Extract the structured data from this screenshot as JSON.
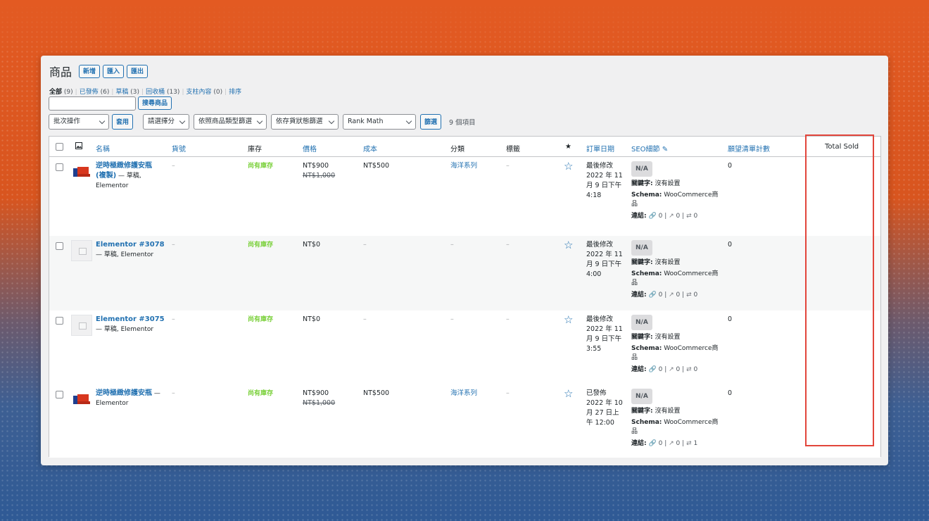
{
  "page": {
    "title": "商品",
    "buttons": [
      "新增",
      "匯入",
      "匯出"
    ]
  },
  "status_links": [
    {
      "label": "全部",
      "count": "(9)",
      "current": true
    },
    {
      "label": "已發佈",
      "count": "(6)"
    },
    {
      "label": "草稿",
      "count": "(3)"
    },
    {
      "label": "回收桶",
      "count": "(13)"
    },
    {
      "label": "支柱內容",
      "count": "(0)"
    },
    {
      "label": "排序",
      "count": ""
    }
  ],
  "search": {
    "button": "搜尋商品",
    "value": ""
  },
  "filters": {
    "bulk": "批次操作",
    "apply": "套用",
    "category": "請選擇分",
    "type": "依照商品類型篩選",
    "stock": "依存貨狀態篩選",
    "rankmath": "Rank Math",
    "filter_btn": "篩選",
    "count": "9 個項目"
  },
  "columns": {
    "name": "名稱",
    "sku": "貨號",
    "stock": "庫存",
    "price": "價格",
    "cost": "成本",
    "category": "分類",
    "tags": "標籤",
    "star": "★",
    "date": "訂單日期",
    "seo": "SEO細節",
    "wishlist": "願望清單計數",
    "total_sold": "Total Sold"
  },
  "seo_labels": {
    "keyword": "關鍵字:",
    "schema": "Schema:",
    "links": "連結:"
  },
  "rows": [
    {
      "name": "逆時極緻修護安瓶(複製)",
      "name_line1": "逆時極緻修護安瓶",
      "name_line2": "(複製)",
      "name_suffix": " — 草稿,",
      "meta": "Elementor",
      "thumb": "product-image",
      "sku": "–",
      "stock": "尚有庫存",
      "price": "NT$900",
      "price_old": "NT$1,000",
      "cost": "NT$500",
      "category": "海洋系列",
      "tags": "–",
      "date_status": "最後修改",
      "date_lines": [
        "2022 年 11",
        "月 9 日下午",
        "4:18"
      ],
      "seo_score": "N/A",
      "keyword": "沒有設置",
      "schema": "WooCommerce商品",
      "schema_l1": "WooCommerce商",
      "schema_l2": "品",
      "links_internal": "0",
      "links_external": "0",
      "links_incoming": "0",
      "wishlist": "0"
    },
    {
      "name": "Elementor #3078",
      "name_line1": "Elementor #3078",
      "name_line2": "",
      "name_suffix": "",
      "meta": "— 草稿, Elementor",
      "thumb": "placeholder",
      "sku": "–",
      "stock": "尚有庫存",
      "price": "NT$0",
      "price_old": "",
      "cost": "–",
      "category": "–",
      "tags": "–",
      "date_status": "最後修改",
      "date_lines": [
        "2022 年 11",
        "月 9 日下午",
        "4:00"
      ],
      "seo_score": "N/A",
      "keyword": "沒有設置",
      "schema_l1": "WooCommerce商",
      "schema_l2": "品",
      "links_internal": "0",
      "links_external": "0",
      "links_incoming": "0",
      "wishlist": "0"
    },
    {
      "name": "Elementor #3075",
      "name_line1": "Elementor #3075",
      "name_line2": "",
      "name_suffix": "",
      "meta": "— 草稿, Elementor",
      "thumb": "placeholder",
      "sku": "–",
      "stock": "尚有庫存",
      "price": "NT$0",
      "price_old": "",
      "cost": "–",
      "category": "–",
      "tags": "–",
      "date_status": "最後修改",
      "date_lines": [
        "2022 年 11",
        "月 9 日下午",
        "3:55"
      ],
      "seo_score": "N/A",
      "keyword": "沒有設置",
      "schema_l1": "WooCommerce商",
      "schema_l2": "品",
      "links_internal": "0",
      "links_external": "0",
      "links_incoming": "0",
      "wishlist": "0"
    },
    {
      "name": "逆時極緻修護安瓶",
      "name_line1": "逆時極緻修護安瓶",
      "name_line2": "",
      "name_suffix": " —",
      "meta": "Elementor",
      "thumb": "product-image",
      "sku": "–",
      "stock": "尚有庫存",
      "price": "NT$900",
      "price_old": "NT$1,000",
      "cost": "NT$500",
      "category": "海洋系列",
      "tags": "–",
      "date_status": "已發佈",
      "date_lines": [
        "2022 年 10",
        "月 27 日上",
        "午 12:00"
      ],
      "seo_score": "N/A",
      "keyword": "沒有設置",
      "schema_l1": "WooCommerce商",
      "schema_l2": "品",
      "links_internal": "0",
      "links_external": "0",
      "links_incoming": "1",
      "wishlist": "0"
    }
  ]
}
